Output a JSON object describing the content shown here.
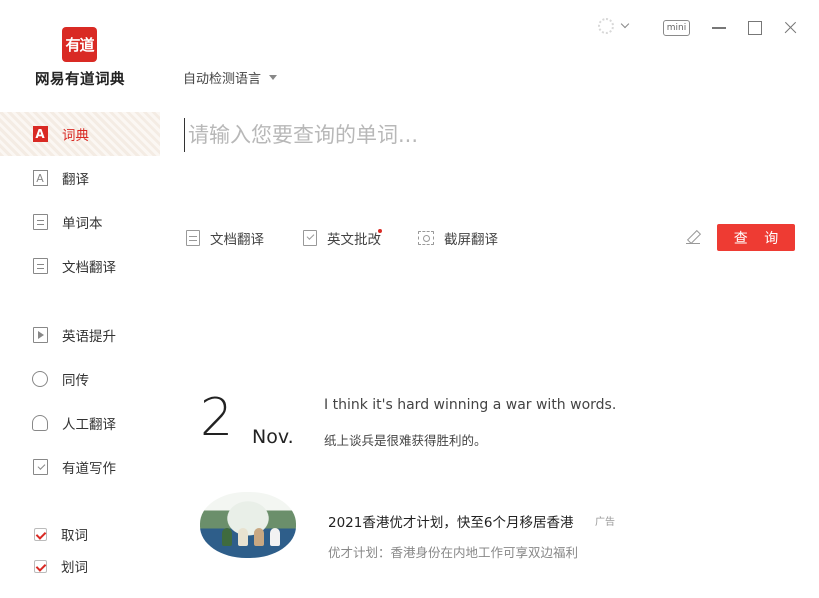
{
  "window": {
    "mini_label": "mini"
  },
  "brand": {
    "logo_text": "有道",
    "app_name": "网易有道词典",
    "accent_color": "#d92a24"
  },
  "sidebar": {
    "items": [
      {
        "label": "词典",
        "icon": "dictionary-icon",
        "active": true
      },
      {
        "label": "翻译",
        "icon": "translate-icon"
      },
      {
        "label": "单词本",
        "icon": "wordbook-icon"
      },
      {
        "label": "文档翻译",
        "icon": "document-icon"
      },
      {
        "label": "英语提升",
        "icon": "video-play-icon"
      },
      {
        "label": "同传",
        "icon": "simultaneous-interpretation-icon"
      },
      {
        "label": "人工翻译",
        "icon": "headset-icon"
      },
      {
        "label": "有道写作",
        "icon": "writing-check-icon"
      }
    ],
    "options": [
      {
        "label": "取词",
        "checked": true
      },
      {
        "label": "划词",
        "checked": true
      }
    ]
  },
  "search": {
    "language": "自动检测语言",
    "placeholder": "请输入您要查询的单词...",
    "value": "",
    "query_label": "查 询"
  },
  "tools": [
    {
      "label": "文档翻译",
      "icon": "document-icon"
    },
    {
      "label": "英文批改",
      "icon": "essay-check-icon",
      "badge": true
    },
    {
      "label": "截屏翻译",
      "icon": "screenshot-icon"
    }
  ],
  "daily": {
    "day": "2",
    "month": "Nov.",
    "sentence_en": "I think it's hard winning a war with words.",
    "sentence_zh": "纸上谈兵是很难获得胜利的。"
  },
  "ad": {
    "title": "2021香港优才计划，快至6个月移居香港",
    "tag": "广告",
    "description": "优才计划：香港身份在内地工作可享双边福利"
  }
}
